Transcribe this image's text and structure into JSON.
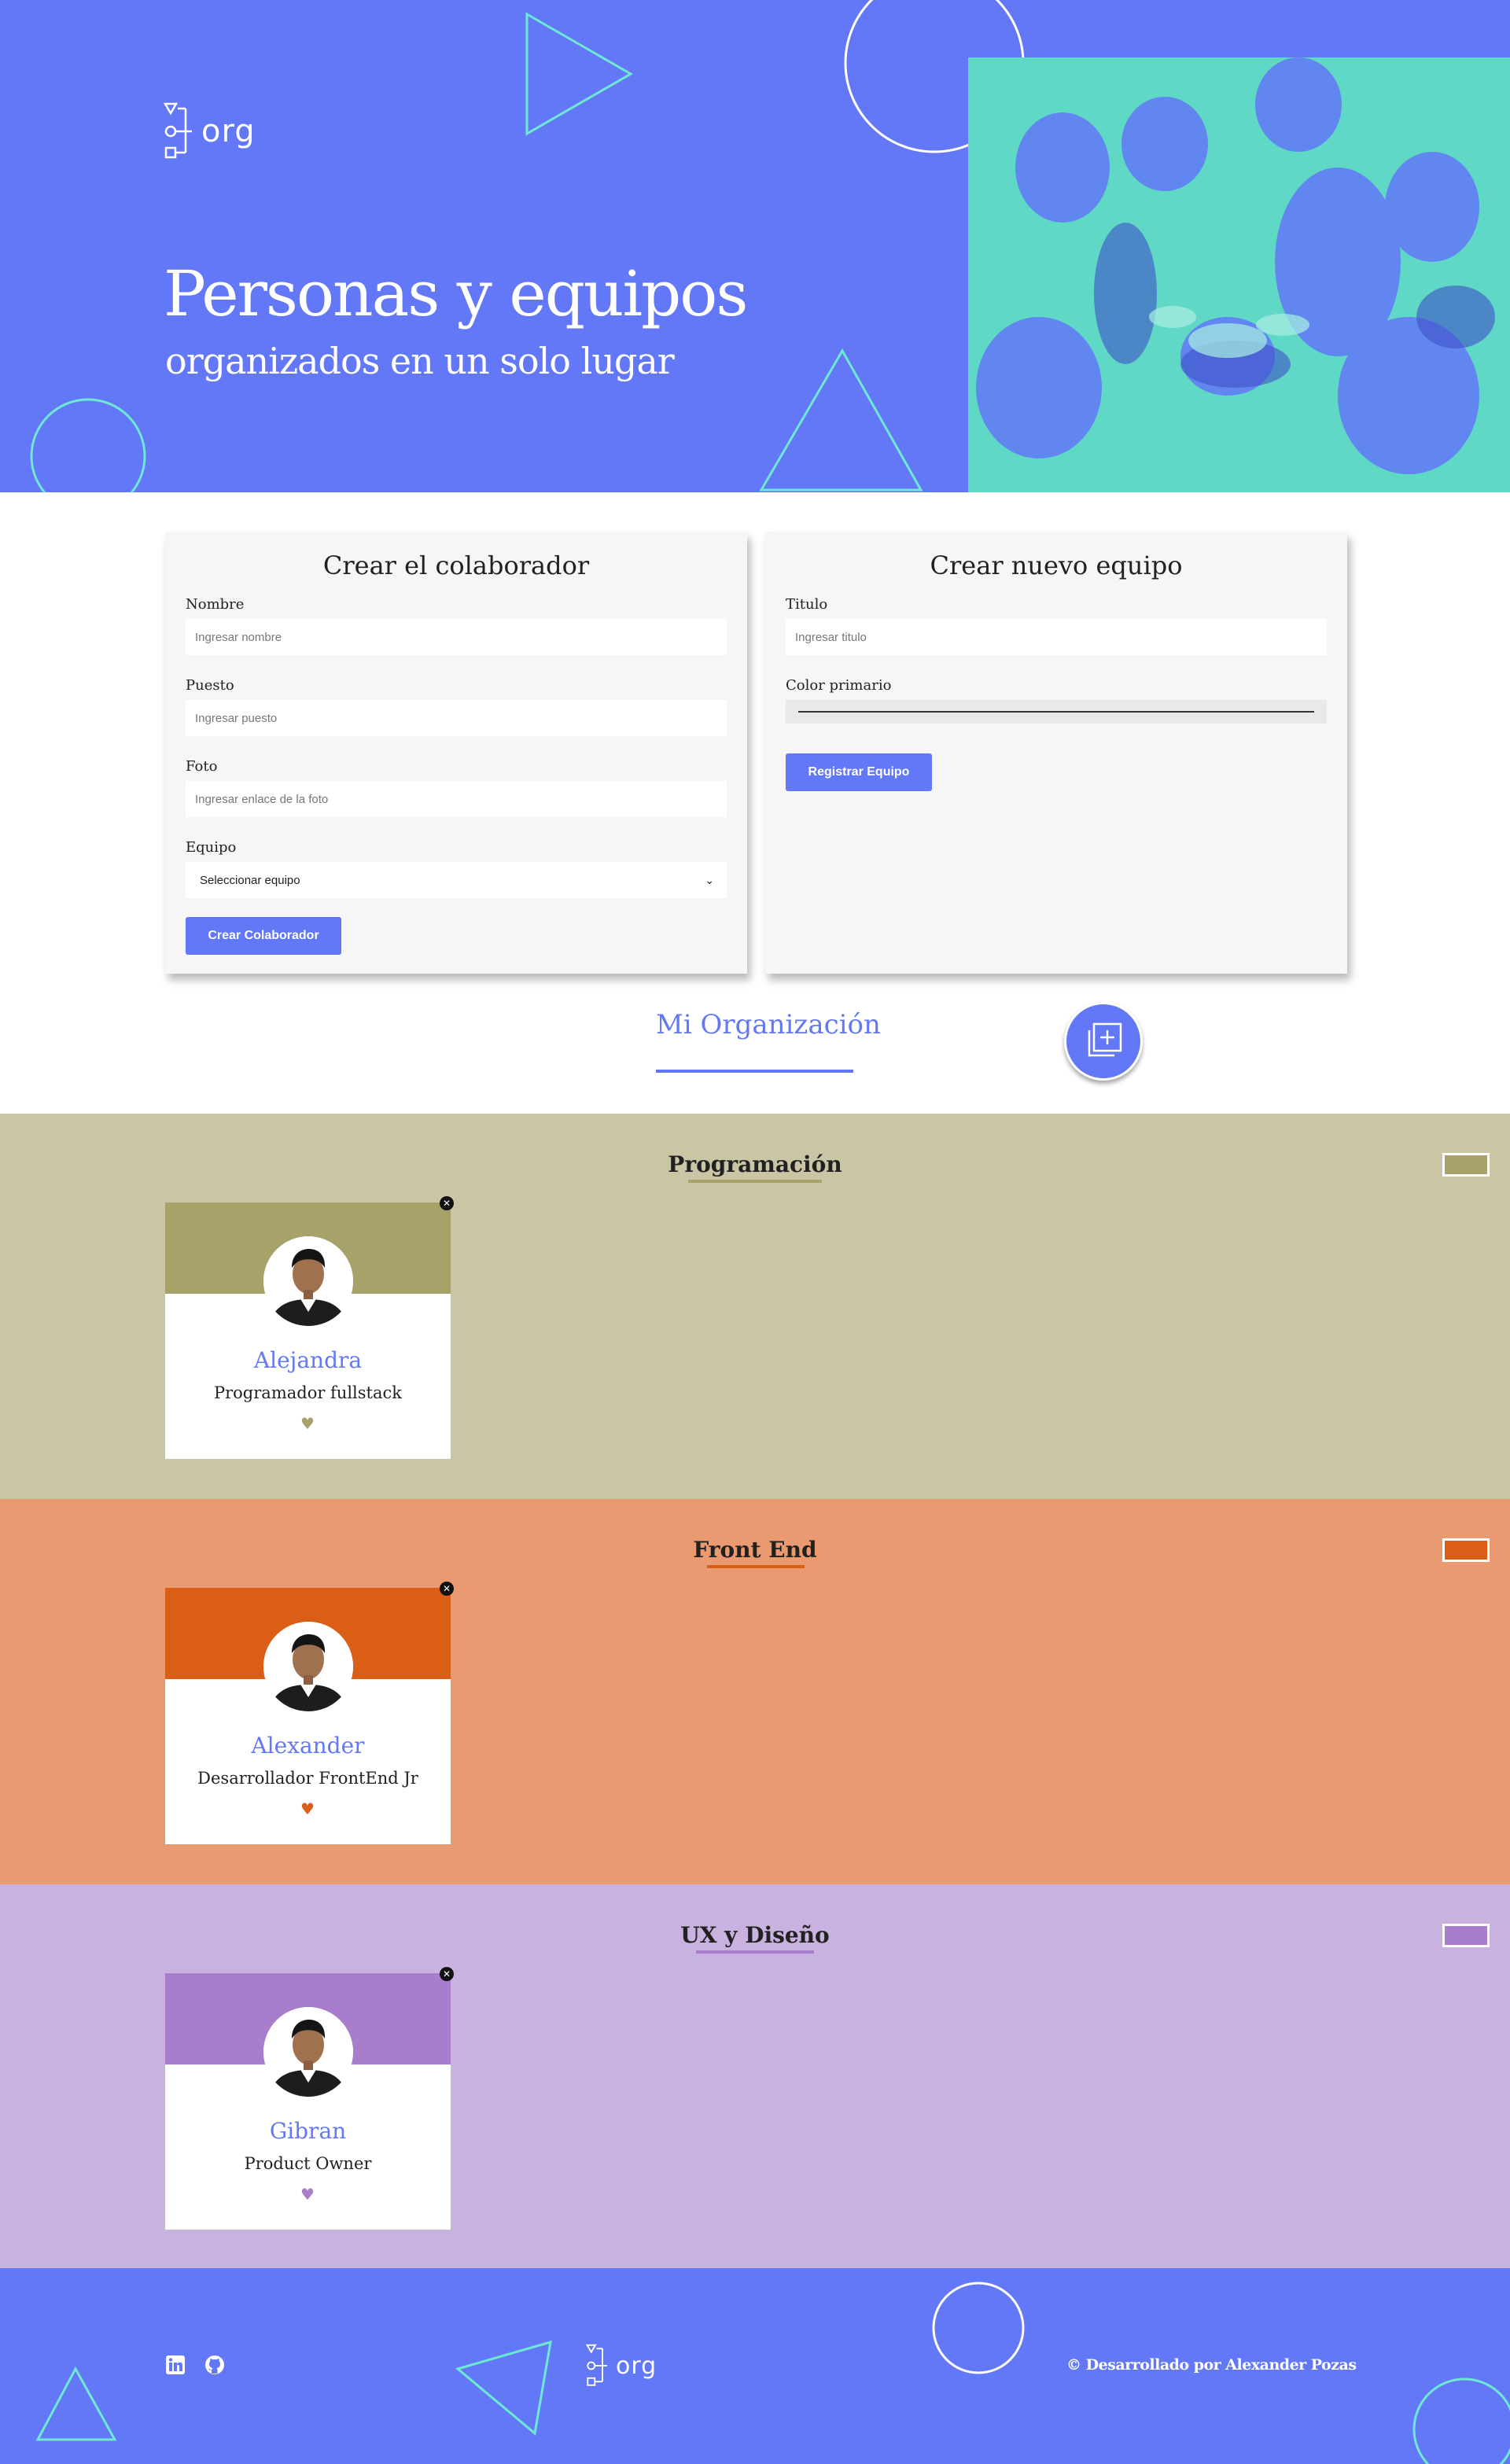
{
  "hero": {
    "logo_text": "org",
    "title": "Personas y equipos",
    "subtitle": "organizados en un solo lugar",
    "image_icon": "team-hands-photo"
  },
  "collaborator_form": {
    "title": "Crear el colaborador",
    "fields": [
      {
        "label": "Nombre",
        "placeholder": "Ingresar nombre"
      },
      {
        "label": "Puesto",
        "placeholder": "Ingresar puesto"
      },
      {
        "label": "Foto",
        "placeholder": "Ingresar enlace de la foto"
      }
    ],
    "team_select": {
      "label": "Equipo",
      "value": "Seleccionar equipo"
    },
    "submit_label": "Crear Colaborador"
  },
  "team_form": {
    "title": "Crear nuevo equipo",
    "title_field": {
      "label": "Titulo",
      "placeholder": "Ingresar titulo"
    },
    "color_field": {
      "label": "Color primario"
    },
    "submit_label": "Registrar Equipo"
  },
  "organization": {
    "title": "Mi Organización",
    "add_icon": "add-collection-icon"
  },
  "teams": [
    {
      "name": "Programación",
      "primary": "#A6A26A",
      "secondary": "#CAC5A5",
      "collaborators": [
        {
          "name": "Alejandra",
          "role": "Programador fullstack"
        }
      ]
    },
    {
      "name": "Front End",
      "primary": "#DB5E17",
      "secondary": "#E99A70",
      "collaborators": [
        {
          "name": "Alexander",
          "role": "Desarrollador FrontEnd Jr"
        }
      ]
    },
    {
      "name": "UX y Diseño",
      "primary": "#A87DCB",
      "secondary": "#CAB2E0",
      "collaborators": [
        {
          "name": "Gibran",
          "role": "Product Owner"
        }
      ]
    }
  ],
  "footer": {
    "logo_text": "org",
    "credits": "© Desarrollado por Alexander Pozas",
    "social_icons": [
      "linkedin-icon",
      "github-icon"
    ]
  },
  "colors": {
    "brand": "#6278F7",
    "accent_shapes": "#6FE8D3"
  }
}
